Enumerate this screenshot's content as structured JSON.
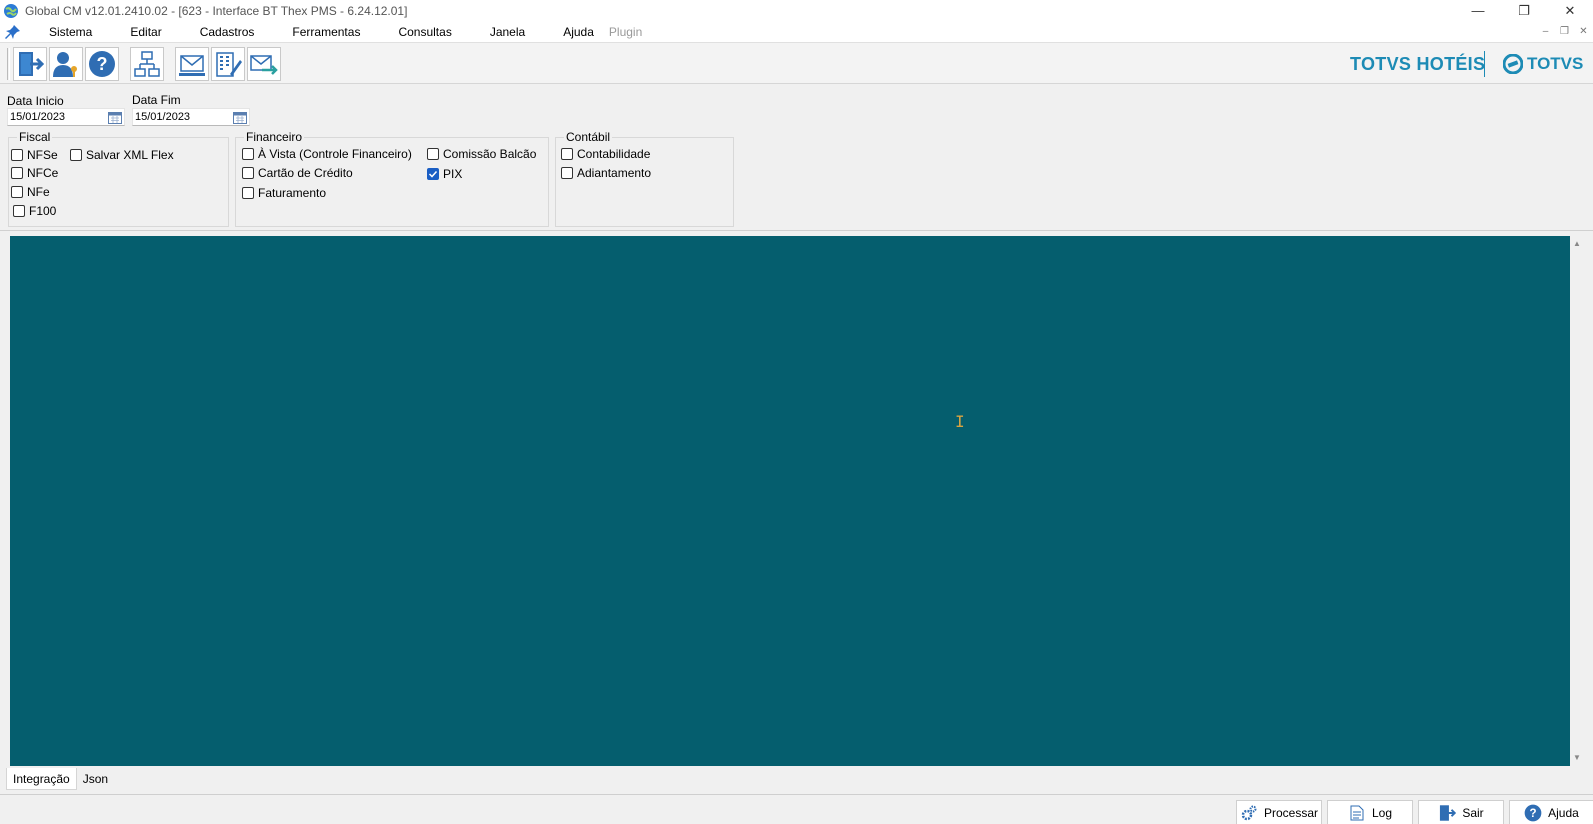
{
  "window": {
    "title": "Global CM v12.01.2410.02 - [623 - Interface BT Thex PMS - 6.24.12.01]",
    "minimize": "—",
    "restore": "❐",
    "close": "✕"
  },
  "menu": {
    "items": [
      "Sistema",
      "Editar",
      "Cadastros",
      "Ferramentas",
      "Consultas",
      "Janela",
      "Ajuda"
    ],
    "plugin": "Plugin",
    "mdi_minimize": "–",
    "mdi_restore": "❐",
    "mdi_close": "✕"
  },
  "toolbar": {
    "icons": [
      "exit-door-icon",
      "user-key-icon",
      "help-icon",
      "network-icon",
      "envelope-icon",
      "building-edit-icon",
      "mail-forward-icon"
    ]
  },
  "brand": {
    "hoteis": "TOTVS HOTÉIS",
    "totvs": "TOTVS",
    "color": "#1d8bb5"
  },
  "filters": {
    "data_inicio_label": "Data Inicio",
    "data_inicio_value": "15/01/2023",
    "data_fim_label": "Data Fim",
    "data_fim_value": "15/01/2023"
  },
  "fiscal": {
    "title": "Fiscal",
    "nfse": "NFSe",
    "nfce": "NFCe",
    "nfe": "NFe",
    "f100": "F100",
    "salvar_xml": "Salvar XML Flex"
  },
  "financeiro": {
    "title": "Financeiro",
    "a_vista": "À Vista (Controle Financeiro)",
    "cartao": "Cartão de Crédito",
    "faturamento": "Faturamento",
    "comissao": "Comissão Balcão",
    "pix": "PIX"
  },
  "contabil": {
    "title": "Contábil",
    "contabilidade": "Contabilidade",
    "adiantamento": "Adiantamento"
  },
  "main_panel": {
    "background": "#055e6e"
  },
  "tabs": {
    "integracao": "Integração",
    "json": "Json"
  },
  "buttons": {
    "processar": "Processar",
    "log": "Log",
    "sair": "Sair",
    "ajuda": "Ajuda"
  }
}
